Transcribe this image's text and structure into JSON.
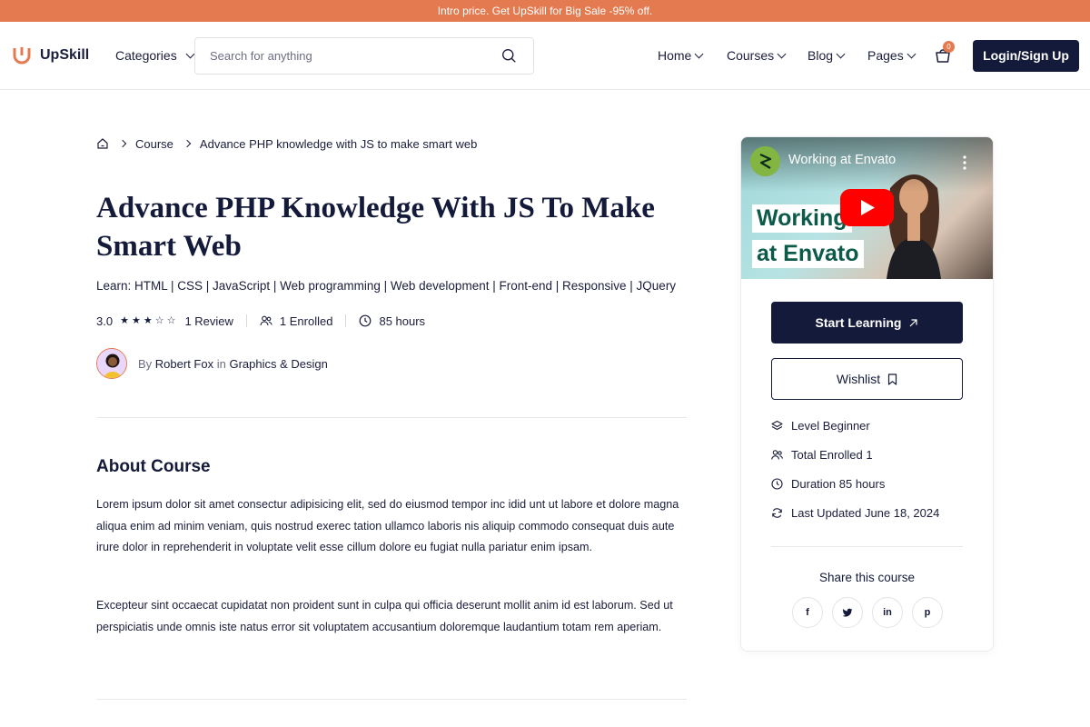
{
  "promo": {
    "text": "Intro price. Get UpSkill for Big Sale -95% off."
  },
  "header": {
    "brand": "UpSkill",
    "categories_label": "Categories",
    "search_placeholder": "Search for anything",
    "menu": [
      {
        "label": "Home"
      },
      {
        "label": "Courses"
      },
      {
        "label": "Blog"
      },
      {
        "label": "Pages"
      }
    ],
    "cart_count": "0",
    "login_label": "Login/Sign Up"
  },
  "breadcrumb": {
    "items": [
      "Course",
      "Advance PHP knowledge with JS to make smart web"
    ]
  },
  "course": {
    "title": "Advance PHP Knowledge With JS To Make Smart Web",
    "learn": "Learn: HTML | CSS | JavaScript | Web programming | Web development | Front-end | Responsive | JQuery",
    "rating": "3.0",
    "rating_value": 3,
    "rating_max": 5,
    "reviews": "1 Review",
    "enrolled": "1 Enrolled",
    "duration": "85 hours",
    "author_by": "By",
    "author_name": "Robert Fox",
    "author_in": "in",
    "category": "Graphics & Design"
  },
  "about": {
    "heading": "About Course",
    "paragraphs": [
      "Lorem ipsum dolor sit amet consectur adipisicing elit, sed do eiusmod tempor inc idid unt ut labore et dolore magna aliqua enim ad minim veniam, quis nostrud exerec tation ullamco laboris nis aliquip commodo consequat duis aute irure dolor in reprehenderit in voluptate velit esse cillum dolore eu fugiat nulla pariatur enim ipsam.",
      "Excepteur sint occaecat cupidatat non proident sunt in culpa qui officia deserunt mollit anim id est laborum. Sed ut perspiciatis unde omnis iste natus error sit voluptatem accusantium doloremque laudantium totam rem aperiam."
    ]
  },
  "sidebar": {
    "video_title": "Working at Envato",
    "video_overlay_line1": "Working",
    "video_overlay_line2": "at Envato",
    "start_label": "Start Learning",
    "wishlist_label": "Wishlist",
    "info": [
      {
        "icon": "layers-icon",
        "label": "Level Beginner"
      },
      {
        "icon": "users-icon",
        "label": "Total Enrolled 1"
      },
      {
        "icon": "clock-icon",
        "label": "Duration 85 hours"
      },
      {
        "icon": "refresh-icon",
        "label": "Last Updated June 18, 2024"
      }
    ],
    "share_heading": "Share this course",
    "social": [
      {
        "icon": "facebook-icon",
        "glyph": "f"
      },
      {
        "icon": "twitter-icon",
        "glyph": "t"
      },
      {
        "icon": "linkedin-icon",
        "glyph": "in"
      },
      {
        "icon": "pinterest-icon",
        "glyph": "p"
      }
    ]
  },
  "colors": {
    "accent": "#e47a4f",
    "navy": "#141a3a",
    "text": "#1a1d3b"
  }
}
